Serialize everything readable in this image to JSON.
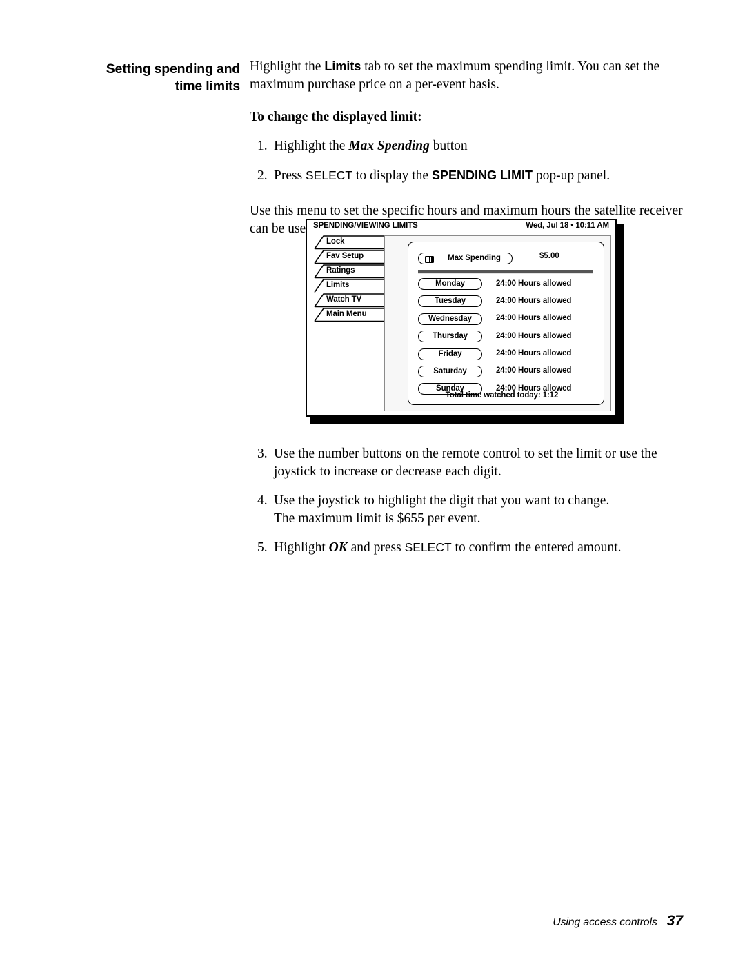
{
  "margin_heading": "Setting spending and\ntime limits",
  "intro": {
    "part1": "Highlight the ",
    "bold_limits": "Limits",
    "part2": " tab to set the maximum spending limit. You can set the maximum purchase price on a per-event basis."
  },
  "subhead": "To change the displayed limit:",
  "steps_top": [
    {
      "num": "1.",
      "part1": "Highlight the ",
      "emph": "Max Spending",
      "part2": " button"
    },
    {
      "num": "2.",
      "part1": "Press ",
      "sans1": "SELECT",
      "part2": " to display the ",
      "sans2": "SPENDING LIMIT",
      "part3": " pop-up panel."
    }
  ],
  "use_menu_para": "Use this menu to set the specific hours and maximum hours the satellite receiver can be used for viewing.",
  "screen": {
    "header_title": "SPENDING/VIEWING LIMITS",
    "header_datetime": "Wed, Jul 18 • 10:11 AM",
    "tabs": [
      {
        "label": "Lock",
        "selected": false
      },
      {
        "label": "Fav Setup",
        "selected": false
      },
      {
        "label": "Ratings",
        "selected": false
      },
      {
        "label": "Limits",
        "selected": true
      },
      {
        "label": "Watch TV",
        "selected": false
      },
      {
        "label": "Main Menu",
        "selected": false
      }
    ],
    "max_spending": {
      "icon": "bar-slider-icon",
      "label": "Max Spending",
      "value": "$5.00"
    },
    "days": [
      {
        "day": "Monday",
        "hours": "24:00 Hours allowed"
      },
      {
        "day": "Tuesday",
        "hours": "24:00 Hours allowed"
      },
      {
        "day": "Wednesday",
        "hours": "24:00 Hours allowed"
      },
      {
        "day": "Thursday",
        "hours": "24:00 Hours allowed"
      },
      {
        "day": "Friday",
        "hours": "24:00 Hours allowed"
      },
      {
        "day": "Saturday",
        "hours": "24:00 Hours allowed"
      },
      {
        "day": "Sunday",
        "hours": "24:00 Hours allowed"
      }
    ],
    "total_time": "Total time watched today:  1:12"
  },
  "steps_bottom": [
    {
      "num": "3.",
      "part1": "Use the number buttons on the remote control to set the limit or use the joystick to increase or decrease each digit."
    },
    {
      "num": "4.",
      "part1": "Use the joystick to highlight the digit that you want to change.",
      "part2": "The maximum limit is $655 per event."
    },
    {
      "num": "5.",
      "part1": "Highlight ",
      "emph": "OK",
      "part2": " and press ",
      "sans1": "SELECT",
      "part3": " to confirm the entered amount."
    }
  ],
  "footer": {
    "text": "Using access controls",
    "page": "37"
  }
}
